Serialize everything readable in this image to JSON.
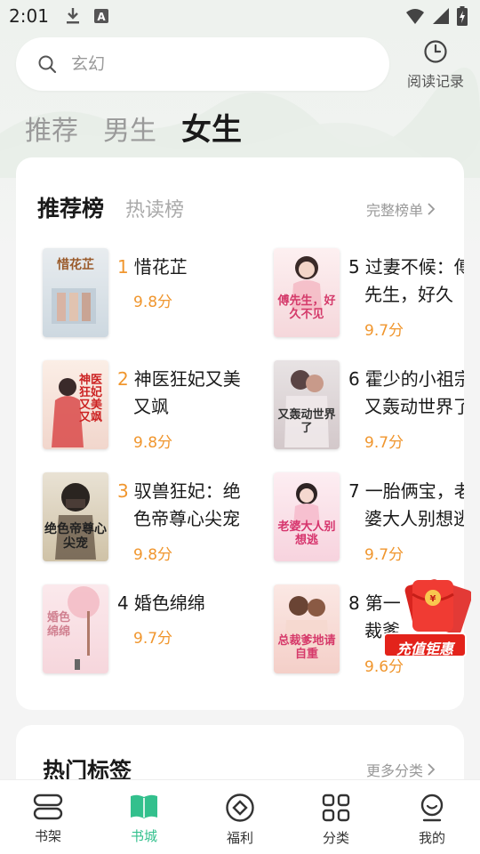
{
  "status_bar": {
    "time": "2:01"
  },
  "search": {
    "placeholder": "玄幻"
  },
  "history": {
    "label": "阅读记录"
  },
  "category_tabs": [
    {
      "label": "推荐",
      "active": false
    },
    {
      "label": "男生",
      "active": false
    },
    {
      "label": "女生",
      "active": true
    }
  ],
  "ranking": {
    "tabs": [
      {
        "label": "推荐榜",
        "active": true
      },
      {
        "label": "热读榜",
        "active": false
      }
    ],
    "full_list_label": "完整榜单",
    "books": [
      {
        "rank": "1",
        "title_line1": "惜花芷",
        "title_line2": "",
        "score": "9.8分",
        "cover_text": "惜花芷"
      },
      {
        "rank": "2",
        "title_line1": "神医狂妃又美",
        "title_line2": "又飒",
        "score": "9.8分",
        "cover_text": "神医狂妃又美又飒"
      },
      {
        "rank": "3",
        "title_line1": "驭兽狂妃：绝",
        "title_line2": "色帝尊心尖宠",
        "score": "9.8分",
        "cover_text": "绝色帝尊心尖宠"
      },
      {
        "rank": "4",
        "title_line1": "婚色绵绵",
        "title_line2": "",
        "score": "9.7分",
        "cover_text": "婚色绵绵"
      },
      {
        "rank": "5",
        "title_line1": "过妻不候：傅",
        "title_line2": "先生，好久",
        "score": "9.7分",
        "cover_text": "傅先生，好久不见"
      },
      {
        "rank": "6",
        "title_line1": "霍少的小祖宗",
        "title_line2": "又轰动世界了",
        "score": "9.7分",
        "cover_text": "又轰动世界了"
      },
      {
        "rank": "7",
        "title_line1": "一胎俩宝，老",
        "title_line2": "婆大人别想逃",
        "score": "9.7分",
        "cover_text": "老婆大人别想逃"
      },
      {
        "rank": "8",
        "title_line1": "第一",
        "title_line2": "裁爹",
        "score": "9.6分",
        "cover_text": "总裁爹地请自重"
      }
    ]
  },
  "promo": {
    "label": "充值钜惠"
  },
  "tags_section": {
    "title": "热门标签",
    "more_label": "更多分类"
  },
  "bottom_nav": [
    {
      "label": "书架",
      "icon": "bookshelf-icon",
      "active": false
    },
    {
      "label": "书城",
      "icon": "book-open-icon",
      "active": true
    },
    {
      "label": "福利",
      "icon": "diamond-icon",
      "active": false
    },
    {
      "label": "分类",
      "icon": "grid-icon",
      "active": false
    },
    {
      "label": "我的",
      "icon": "profile-icon",
      "active": false
    }
  ],
  "colors": {
    "accent": "#33c08d",
    "rank_orange": "#f0962e"
  }
}
